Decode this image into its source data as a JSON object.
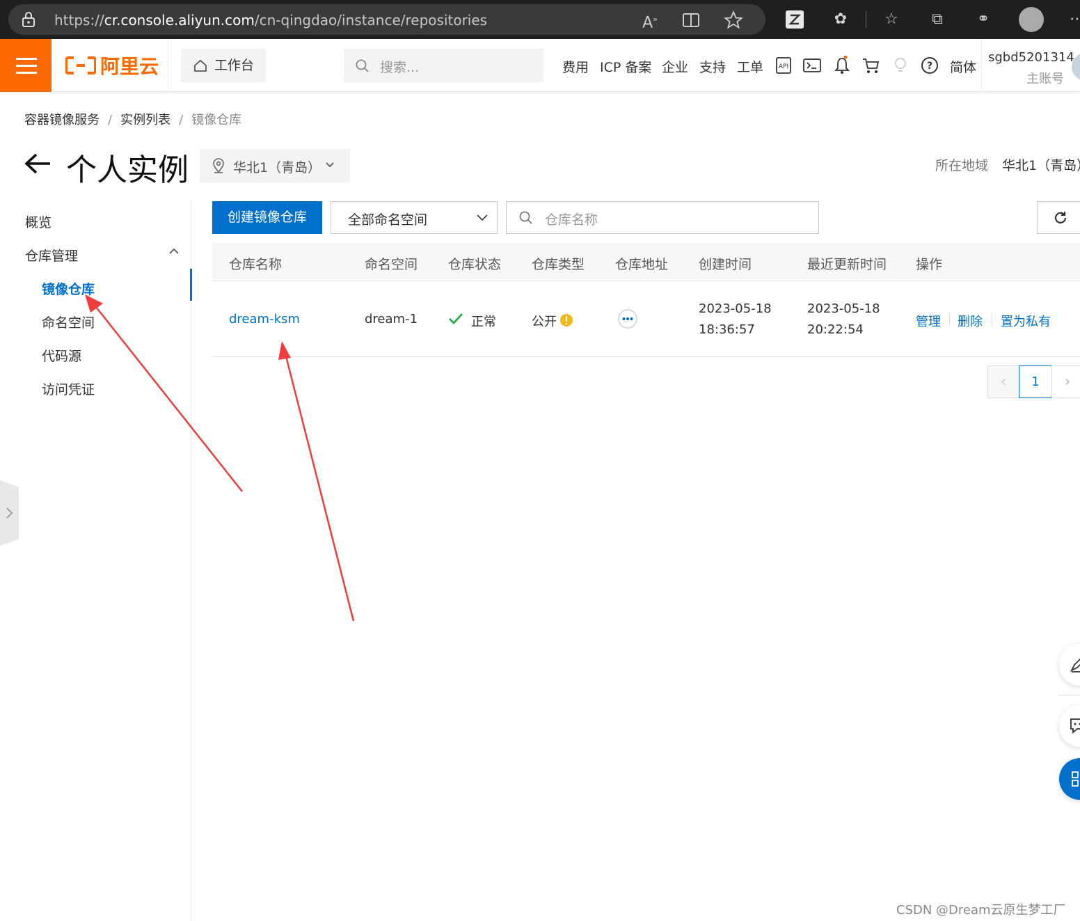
{
  "browser": {
    "url_prefix": "https://",
    "url_host": "cr.console.aliyun.com",
    "url_path": "/cn-qingdao/instance/repositories"
  },
  "topnav": {
    "logo_text": "阿里云",
    "workbench_label": "工作台",
    "search_placeholder": "搜索...",
    "links": [
      "费用",
      "ICP 备案",
      "企业",
      "支持",
      "工单"
    ],
    "lang": "简体",
    "user_name": "sgbd5201314",
    "user_role": "主账号",
    "accent": "#ff6a00"
  },
  "breadcrumb": [
    "容器镜像服务",
    "实例列表",
    "镜像仓库"
  ],
  "header": {
    "title": "个人实例",
    "region_selected": "华北1（青岛）",
    "region_label": "所在地域",
    "region_value": "华北1（青岛）"
  },
  "sidebar": {
    "overview": "概览",
    "repo_group": "仓库管理",
    "items": [
      "镜像仓库",
      "命名空间",
      "代码源",
      "访问凭证"
    ],
    "active_index": 0
  },
  "toolbar": {
    "create_label": "创建镜像仓库",
    "namespace_select": "全部命名空间",
    "search_placeholder": "仓库名称"
  },
  "table": {
    "columns": [
      "仓库名称",
      "命名空间",
      "仓库状态",
      "仓库类型",
      "仓库地址",
      "创建时间",
      "最近更新时间",
      "操作"
    ],
    "rows": [
      {
        "name": "dream-ksm",
        "namespace": "dream-1",
        "status": "正常",
        "type": "公开",
        "created_date": "2023-05-18",
        "created_time": "18:36:57",
        "updated_date": "2023-05-18",
        "updated_time": "20:22:54",
        "actions": [
          "管理",
          "删除",
          "置为私有"
        ]
      }
    ]
  },
  "pagination": {
    "current": "1"
  },
  "watermark": "CSDN @Dream云原生梦工厂",
  "colors": {
    "primary": "#0070cc",
    "annotation_arrow": "#f03c3c",
    "status_ok": "#1fa83a"
  }
}
